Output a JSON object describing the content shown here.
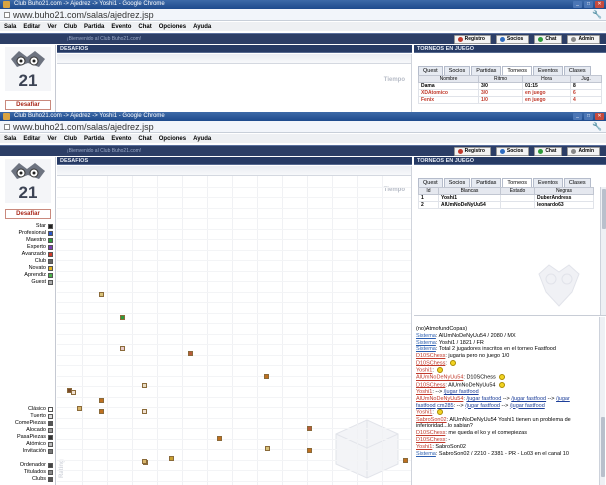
{
  "window": {
    "title": "Club Buho21.com -> Ajedrez -> Yoshi1 - Google Chrome",
    "url": "www.buho21.com/salas/ajedrez.jsp"
  },
  "menu": [
    "Sala",
    "Editar",
    "Ver",
    "Club",
    "Partida",
    "Evento",
    "Chat",
    "Opciones",
    "Ayuda"
  ],
  "welcome": "¡Bienvenido al Club Buho21.com!",
  "toolbar_buttons": [
    "Registro",
    "Socios",
    "Chat",
    "Admin"
  ],
  "logo_text": "21",
  "challenge_button": "Desafiar",
  "player_levels": [
    {
      "label": "Star",
      "color": "#222222"
    },
    {
      "label": "Profesional",
      "color": "#2b56c9"
    },
    {
      "label": "Maestro",
      "color": "#2e9a3a"
    },
    {
      "label": "Experto",
      "color": "#7b3fb5"
    },
    {
      "label": "Avanzado",
      "color": "#d23a2a"
    },
    {
      "label": "Club",
      "color": "#666666"
    },
    {
      "label": "Novato",
      "color": "#e3b31e"
    },
    {
      "label": "Aprendiz",
      "color": "#4bb44b"
    },
    {
      "label": "Guest",
      "color": "#aaaaaa"
    }
  ],
  "game_types": [
    {
      "label": "Clásico"
    },
    {
      "label": "Tuerto"
    },
    {
      "label": "ComePiezas"
    },
    {
      "label": "Alocado"
    },
    {
      "label": "PasaPiezas"
    },
    {
      "label": "Atómico"
    },
    {
      "label": "Invitación"
    }
  ],
  "sort_options": [
    {
      "label": "Ordenador"
    },
    {
      "label": "Titulados"
    },
    {
      "label": "Clubs"
    }
  ],
  "challenges_panel": {
    "title": "DESAFIOS",
    "axis_time": "Tiempo",
    "axis_rating": "Rating"
  },
  "tournaments_panel": {
    "title": "TORNEOS EN JUEGO",
    "tabs": [
      "Quest",
      "Socios",
      "Partidas",
      "Torneos",
      "Eventos",
      "Clases"
    ],
    "active_tab": "Torneos"
  },
  "background_window": {
    "columns": [
      "Nombre",
      "Ritmo",
      "Hora",
      "Jug."
    ],
    "rows": [
      [
        "Dama",
        "3/0",
        "01:15",
        "8"
      ],
      [
        "XDAtomico",
        "3/0",
        "en juego",
        "6"
      ],
      [
        "Fenix",
        "1/0",
        "en juego",
        "4"
      ]
    ]
  },
  "tournament_table": {
    "columns": [
      "Id",
      "Blancas",
      "Estado",
      "Negras"
    ],
    "rows": [
      [
        "1",
        "Yoshi1",
        "",
        "DuberAndress"
      ],
      [
        "2",
        "AlUmNoDeNyUu54",
        "",
        "leonardo63"
      ]
    ]
  },
  "chat": [
    {
      "parts": [
        {
          "t": "(no)AtmofundCopas)",
          "c": "plain"
        }
      ]
    },
    {
      "parts": [
        {
          "t": "Sistema",
          "c": "sys"
        },
        {
          "t": ": AlUmNoDeNyUu54 / 2080 / MX",
          "c": "plain"
        }
      ]
    },
    {
      "parts": [
        {
          "t": "Sistema",
          "c": "sys"
        },
        {
          "t": ": Yoshi1 / 1821 / FR",
          "c": "plain"
        }
      ]
    },
    {
      "parts": [
        {
          "t": "Sistema",
          "c": "sys"
        },
        {
          "t": ": Total 2 jugadores inscritos en el torneo Fastfood",
          "c": "plain"
        }
      ]
    },
    {
      "parts": [
        {
          "t": "D10SChess",
          "c": "usr"
        },
        {
          "t": ": jugaria pero no juego 1/0",
          "c": "plain"
        }
      ]
    },
    {
      "parts": [
        {
          "t": "D10SChess",
          "c": "usr"
        },
        {
          "t": ":",
          "c": "plain"
        }
      ],
      "emoji": true
    },
    {
      "parts": [
        {
          "t": "Yoshi1",
          "c": "usr"
        },
        {
          "t": ":",
          "c": "plain"
        }
      ],
      "emoji": true
    },
    {
      "parts": [
        {
          "t": "AlUmNoDeNyUu54",
          "c": "usr"
        },
        {
          "t": ": D10SChess",
          "c": "plain"
        }
      ],
      "emoji": true
    },
    {
      "parts": [
        {
          "t": "D10SChess",
          "c": "usr"
        },
        {
          "t": ": AlUmNoDeNyUu54",
          "c": "plain"
        }
      ],
      "emoji": true
    },
    {
      "parts": [
        {
          "t": "Yoshi1",
          "c": "usr"
        },
        {
          "t": ": --> ",
          "c": "plain"
        },
        {
          "t": "/jugar fastfood",
          "c": "lnk"
        }
      ]
    },
    {
      "parts": [
        {
          "t": "AlUmNoDeNyUu54",
          "c": "usr"
        },
        {
          "t": ": ",
          "c": "plain"
        },
        {
          "t": "/jugar fastfood",
          "c": "lnk"
        },
        {
          "t": " --> ",
          "c": "plain"
        },
        {
          "t": "/jugar fastfood",
          "c": "lnk"
        },
        {
          "t": " --> ",
          "c": "plain"
        },
        {
          "t": "/jugar",
          "c": "lnk"
        }
      ]
    },
    {
      "parts": [
        {
          "t": "fastfood",
          "c": "lnk"
        },
        {
          "t": " ",
          "c": "plain"
        },
        {
          "t": "cm285",
          "c": "lnk"
        },
        {
          "t": ": --> ",
          "c": "plain"
        },
        {
          "t": "/jugar fastfood",
          "c": "lnk"
        },
        {
          "t": " --> ",
          "c": "plain"
        },
        {
          "t": "/jugar fastfood",
          "c": "lnk"
        }
      ]
    },
    {
      "parts": [
        {
          "t": "Yoshi1",
          "c": "usr"
        },
        {
          "t": ":",
          "c": "plain"
        }
      ],
      "emoji": true
    },
    {
      "parts": [
        {
          "t": "SabroSon02",
          "c": "usr"
        },
        {
          "t": ": AlUmNoDeNyUu54 Yoshi1 tienen un problema de",
          "c": "plain"
        }
      ]
    },
    {
      "parts": [
        {
          "t": "inferioridad...lo sabian?",
          "c": "plain"
        }
      ]
    },
    {
      "parts": [
        {
          "t": "D10SChess",
          "c": "usr"
        },
        {
          "t": ": me queda el ko y el comepiezas",
          "c": "plain"
        }
      ]
    },
    {
      "parts": [
        {
          "t": "D10SChess",
          "c": "usr"
        },
        {
          "t": ": -",
          "c": "plain"
        }
      ]
    },
    {
      "parts": [
        {
          "t": "Yoshi1",
          "c": "usr"
        },
        {
          "t": ": SabroSon02",
          "c": "plain"
        }
      ]
    },
    {
      "parts": [
        {
          "t": "Sistema",
          "c": "sys"
        },
        {
          "t": ": SabroSon02 / 2210 - 2381 - PR - Lo03 en el canal 10",
          "c": "plain"
        }
      ]
    }
  ],
  "challenge_points": [
    {
      "color": "#d8c27a"
    },
    {
      "color": "#2e9a3a"
    },
    {
      "color": "#e8c8c8"
    },
    {
      "color": "#b85b3a"
    },
    {
      "color": "#c0701f"
    },
    {
      "color": "#e8dcc4"
    },
    {
      "color": "#c0701f"
    },
    {
      "color": "#f0e0d0"
    },
    {
      "color": "#d8b56a"
    },
    {
      "color": "#7a4a2a"
    },
    {
      "color": "#c0701f"
    },
    {
      "color": "#f0e0d0"
    },
    {
      "color": "#b85b3a"
    },
    {
      "color": "#c0701f"
    },
    {
      "color": "#d8c27a"
    },
    {
      "color": "#c0701f"
    },
    {
      "color": "#c0701f"
    },
    {
      "color": "#d8b56a"
    },
    {
      "color": "#c8a030"
    },
    {
      "color": "#c0701f"
    }
  ]
}
